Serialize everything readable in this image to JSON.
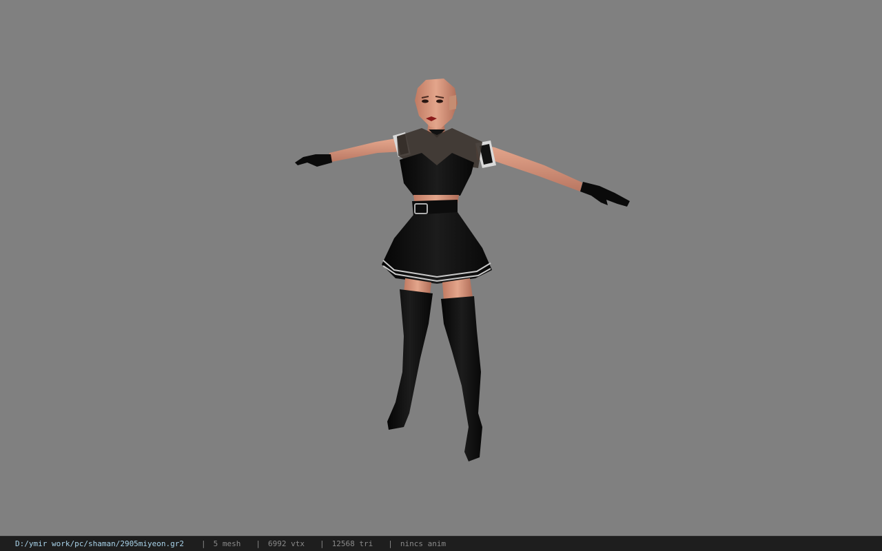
{
  "viewport": {
    "background_color": "#808080",
    "model_description_icon": "character-model"
  },
  "statusbar": {
    "file_path": "D:/ymir work/pc/shaman/2905miyeon.gr2",
    "separator": "|",
    "mesh_count": "5 mesh",
    "vertex_count": "6992 vtx",
    "triangle_count": "12568 tri",
    "animation": "nincs anim"
  },
  "colors": {
    "status_bg": "#1e1e1e",
    "path_color": "#a9d3ea",
    "status_text": "#8a8a8a"
  }
}
